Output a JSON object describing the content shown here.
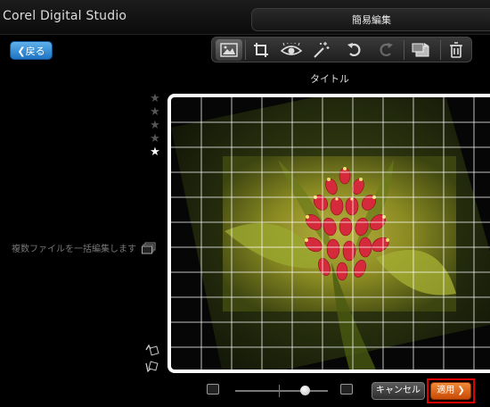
{
  "app": {
    "title": "Corel Digital Studio"
  },
  "mode": {
    "title": "簡易編集"
  },
  "nav": {
    "back_label": "戻る"
  },
  "toolbar": {
    "tools": [
      {
        "icon": "photo-fix-icon",
        "state": "active"
      },
      {
        "icon": "crop-icon",
        "state": "normal"
      },
      {
        "icon": "red-eye-icon",
        "state": "normal"
      },
      {
        "icon": "auto-enhance-icon",
        "state": "normal"
      },
      {
        "icon": "undo-icon",
        "state": "normal"
      },
      {
        "icon": "redo-icon",
        "state": "disabled"
      },
      {
        "icon": "save-as-icon",
        "state": "normal"
      },
      {
        "icon": "delete-icon",
        "state": "normal"
      }
    ]
  },
  "photo": {
    "title": "タイトル",
    "rating": 1,
    "rating_max": 5,
    "straighten_grid": "on"
  },
  "sidebar": {
    "batch_edit_label": "複数ファイルを一括編集します"
  },
  "zoom": {
    "level": 0.75
  },
  "actions": {
    "cancel_label": "キャンセル",
    "apply_label": "適用"
  },
  "colors": {
    "accent_blue": "#2f86d6",
    "apply_orange": "#e06a1a",
    "highlight_red": "#e00000"
  }
}
